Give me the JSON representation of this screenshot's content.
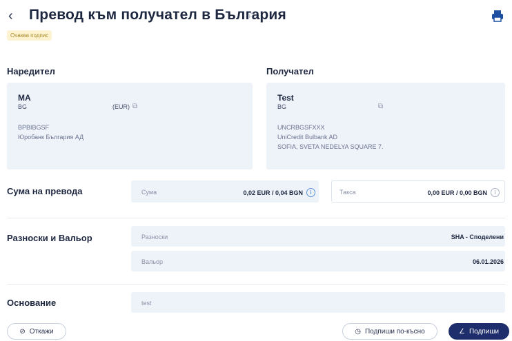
{
  "header": {
    "back_icon": "chevron-left-icon",
    "title": "Превод към получател в България",
    "star_icon": "star-icon",
    "print_icon": "printer-icon",
    "status_badge": "Очаква подпис"
  },
  "sender": {
    "section_label": "Наредител",
    "name": "MA",
    "iban": "BG",
    "currency": "(EUR)",
    "bic": "BPBIBGSF",
    "bank": "Юробанк България АД"
  },
  "recipient": {
    "section_label": "Получател",
    "name": "Test",
    "iban": "BG",
    "bic": "UNCRBGSFXXX",
    "bank": "UniCredit Bulbank AD",
    "address": "SOFIA, SVETA NEDELYA SQUARE 7."
  },
  "amount": {
    "section_label": "Сума на превода",
    "amount_label": "Сума",
    "amount_value": "0,02 EUR / 0,04 BGN",
    "fee_label": "Такса",
    "fee_value": "0,00 EUR / 0,00 BGN"
  },
  "charges": {
    "section_label": "Разноски и Вальор",
    "charges_label": "Разноски",
    "charges_value": "SHA - Споделени",
    "valor_label": "Вальор",
    "valor_value": "06.01.2026"
  },
  "basis": {
    "section_label": "Основание",
    "value": "test"
  },
  "actions": {
    "cancel_label": "Откажи",
    "sign_later_label": "Подпиши по-късно",
    "sign_label": "Подпиши"
  },
  "colors": {
    "primary": "#1e2d6b",
    "card_bg": "#eef3f9",
    "badge_bg": "#fdf3d0"
  }
}
